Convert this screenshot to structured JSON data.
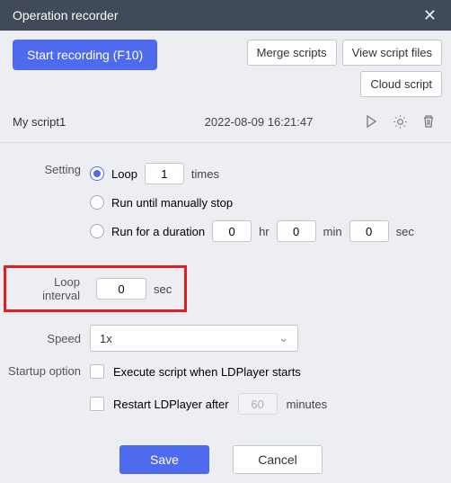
{
  "window": {
    "title": "Operation recorder"
  },
  "toolbar": {
    "start_recording": "Start recording (F10)",
    "merge_scripts": "Merge scripts",
    "view_files": "View script files",
    "cloud_script": "Cloud script"
  },
  "script": {
    "name": "My script1",
    "timestamp": "2022-08-09 16:21:47"
  },
  "labels": {
    "setting": "Setting",
    "loop": "Loop",
    "times": "times",
    "run_until_stop": "Run until manually stop",
    "run_duration": "Run for a duration",
    "hr": "hr",
    "min": "min",
    "sec": "sec",
    "loop_interval": "Loop interval",
    "speed": "Speed",
    "startup_option": "Startup option",
    "execute_on_start": "Execute script when LDPlayer starts",
    "restart_after": "Restart LDPlayer after",
    "minutes": "minutes",
    "save": "Save",
    "cancel": "Cancel"
  },
  "values": {
    "loop_times": "1",
    "dur_hr": "0",
    "dur_min": "0",
    "dur_sec": "0",
    "loop_interval": "0",
    "speed": "1x",
    "restart_minutes": "60"
  }
}
